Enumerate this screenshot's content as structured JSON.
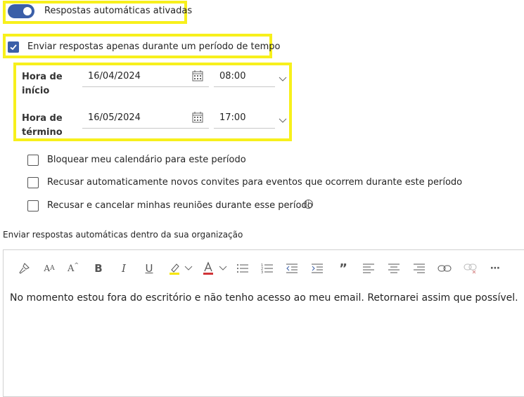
{
  "auto_reply": {
    "toggle_label": "Respostas automáticas ativadas",
    "toggle_on": true
  },
  "schedule": {
    "checkbox_label": "Enviar respostas apenas durante um período de tempo",
    "checked": true,
    "start": {
      "label_line1": "Hora de",
      "label_line2": "início",
      "date": "16/04/2024",
      "time": "08:00"
    },
    "end": {
      "label_line1": "Hora de",
      "label_line2": "término",
      "date": "16/05/2024",
      "time": "17:00"
    }
  },
  "options": [
    {
      "label": "Bloquear meu calendário para este período",
      "checked": false
    },
    {
      "label": "Recusar automaticamente novos convites para eventos que ocorrem durante este período",
      "checked": false
    },
    {
      "label": "Recusar e cancelar minhas reuniões durante esse período",
      "checked": false
    }
  ],
  "internal_section": {
    "title": "Enviar respostas automáticas dentro da sua organização",
    "message": "No momento estou fora do escritório e não tenho acesso ao meu email. Retornarei assim que possível."
  },
  "toolbar_icons": [
    "format-painter-icon",
    "font-size-icon",
    "increase-font-icon",
    "bold-icon",
    "italic-icon",
    "underline-icon",
    "highlight-icon",
    "font-color-icon",
    "bullets-icon",
    "numbering-icon",
    "decrease-indent-icon",
    "increase-indent-icon",
    "quote-icon",
    "align-left-icon",
    "align-center-icon",
    "align-right-icon",
    "link-icon",
    "unlink-icon",
    "more-options-icon"
  ],
  "colors": {
    "accent": "#3b5fa8",
    "highlight_box": "#f7f01c",
    "highlight_color": "#f7e600",
    "font_color": "#d13438"
  }
}
